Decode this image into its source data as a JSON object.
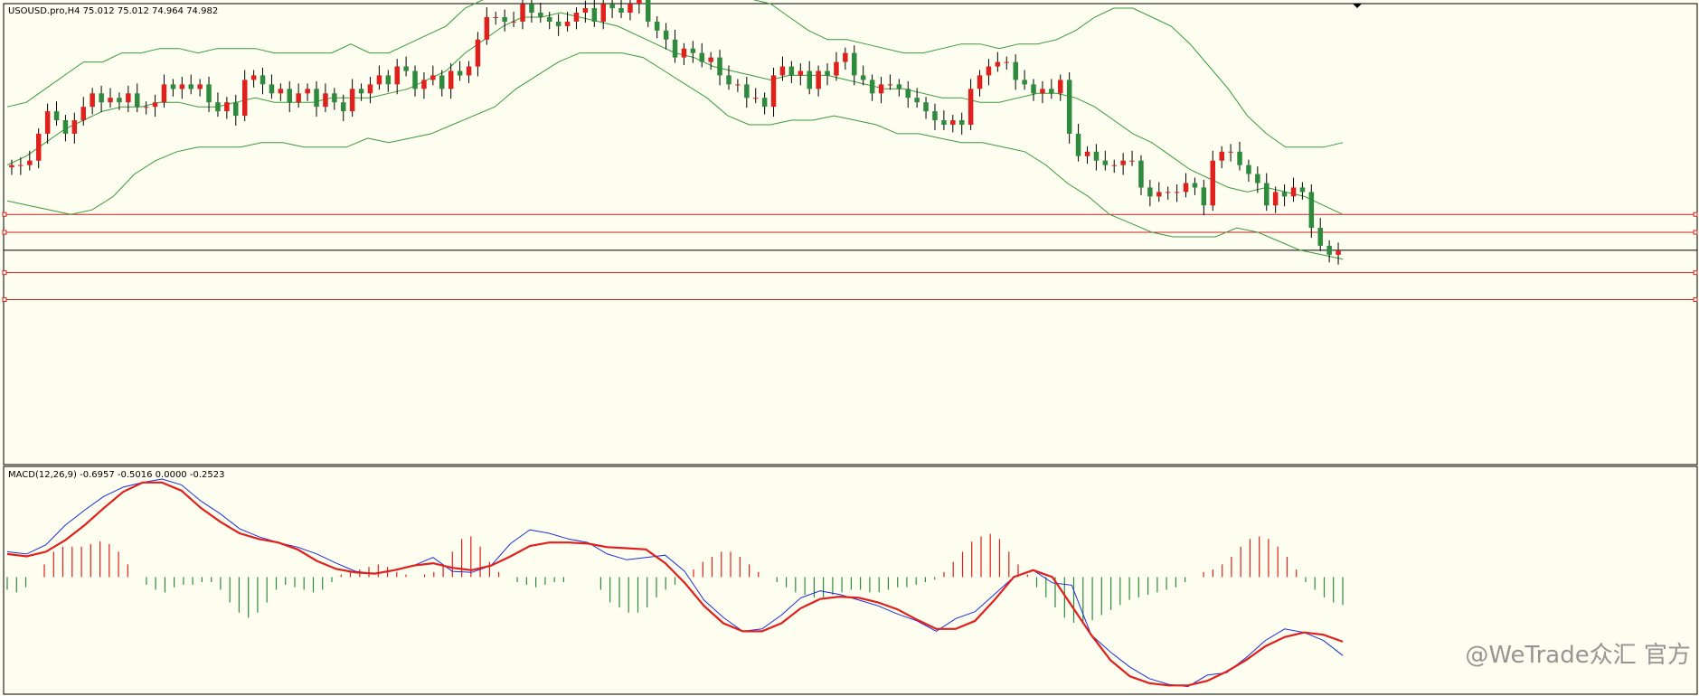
{
  "window": {
    "price_header": "USOUSD.pro,H4  75.012 75.012 74.964 74.982",
    "macd_header": "MACD(12,26,9) -0.6957 -0.5016 0.0000 -0.2523",
    "watermark": "@WeTrade众汇 官方"
  },
  "colors": {
    "background": "#fdfdf0",
    "bull_candle": "#e0201c",
    "bear_candle": "#2e8b3e",
    "bollinger": "#3a9a3a",
    "level_lines": "#d02020",
    "current_price_line": "#000000",
    "macd_line": "#1c2fd8",
    "signal_line": "#e0201c",
    "hist_positive": "#e0201c",
    "hist_negative": "#2e8b3e"
  },
  "chart_data": [
    {
      "type": "candlestick",
      "symbol": "USOUSD.pro",
      "timeframe": "H4",
      "ohlc_last": {
        "open": 75.012,
        "high": 75.012,
        "low": 74.964,
        "close": 74.982
      },
      "ylim": [
        73.0,
        83.0
      ],
      "close_series": [
        79.6,
        79.6,
        79.7,
        80.3,
        80.8,
        80.6,
        80.3,
        80.6,
        80.9,
        81.2,
        81.0,
        81.1,
        81.0,
        81.2,
        80.9,
        80.9,
        81.0,
        81.4,
        81.3,
        81.4,
        81.3,
        81.4,
        81.0,
        80.8,
        81.0,
        80.7,
        81.5,
        81.6,
        81.4,
        81.2,
        81.3,
        81.0,
        81.2,
        81.3,
        80.9,
        81.2,
        81.0,
        80.8,
        81.3,
        81.2,
        81.4,
        81.6,
        81.4,
        81.8,
        81.7,
        81.3,
        81.5,
        81.6,
        81.3,
        81.7,
        81.6,
        81.8,
        82.4,
        82.9,
        82.9,
        82.8,
        82.8,
        83.2,
        83.0,
        82.9,
        82.8,
        82.7,
        82.8,
        83.0,
        83.1,
        82.8,
        83.2,
        83.1,
        83.0,
        83.2,
        83.3,
        82.8,
        82.6,
        82.4,
        82.0,
        82.2,
        82.1,
        81.9,
        82.0,
        81.6,
        81.4,
        81.4,
        81.1,
        81.1,
        80.9,
        81.6,
        81.8,
        81.6,
        81.7,
        81.3,
        81.7,
        81.6,
        81.9,
        82.1,
        81.6,
        81.5,
        81.2,
        81.4,
        81.4,
        81.3,
        81.1,
        81.0,
        80.8,
        80.6,
        80.5,
        80.6,
        80.5,
        81.3,
        81.6,
        81.8,
        81.9,
        81.9,
        81.5,
        81.4,
        81.2,
        81.3,
        81.2,
        81.5,
        80.3,
        79.8,
        79.9,
        79.7,
        79.6,
        79.6,
        79.7,
        79.7,
        79.1,
        78.9,
        79.0,
        79.0,
        79.0,
        79.2,
        79.1,
        78.7,
        79.7,
        79.9,
        79.9,
        79.6,
        79.4,
        79.2,
        78.7,
        79.0,
        78.9,
        79.1,
        79.0,
        78.2,
        77.8,
        77.6,
        77.7
      ]
    },
    {
      "type": "line",
      "name": "Bollinger Bands",
      "upper": [
        80.9,
        81.0,
        81.3,
        81.6,
        81.9,
        81.9,
        82.1,
        82.1,
        82.2,
        82.2,
        82.1,
        82.2,
        82.2,
        82.2,
        82.1,
        82.1,
        82.1,
        82.1,
        82.3,
        82.1,
        82.1,
        82.3,
        82.5,
        82.7,
        83.1,
        83.3,
        83.5,
        83.7,
        83.8,
        83.8,
        83.7,
        83.7,
        83.6,
        83.7,
        83.6,
        83.7,
        83.7,
        83.6,
        83.5,
        83.3,
        83.2,
        82.9,
        82.6,
        82.4,
        82.4,
        82.3,
        82.2,
        82.1,
        82.1,
        82.2,
        82.3,
        82.3,
        82.2,
        82.3,
        82.3,
        82.4,
        82.6,
        82.9,
        83.1,
        83.1,
        82.9,
        82.7,
        82.3,
        81.8,
        81.3,
        80.7,
        80.3,
        80.0,
        80.0,
        80.0,
        80.1
      ],
      "middle": [
        79.6,
        79.8,
        80.1,
        80.4,
        80.6,
        80.8,
        80.9,
        80.9,
        81.0,
        81.0,
        80.9,
        80.9,
        81.0,
        81.1,
        81.0,
        81.0,
        81.0,
        81.1,
        81.1,
        81.1,
        81.2,
        81.3,
        81.5,
        81.7,
        82.1,
        82.4,
        82.7,
        82.9,
        82.9,
        83.0,
        82.9,
        82.8,
        82.7,
        82.5,
        82.3,
        82.1,
        82.0,
        81.8,
        81.7,
        81.6,
        81.5,
        81.6,
        81.6,
        81.6,
        81.5,
        81.4,
        81.3,
        81.3,
        81.2,
        81.1,
        81.1,
        81.0,
        81.0,
        81.1,
        81.2,
        81.2,
        81.1,
        80.9,
        80.6,
        80.3,
        80.1,
        79.8,
        79.5,
        79.3,
        79.1,
        79.0,
        79.1,
        79.0,
        78.9,
        78.7,
        78.5
      ],
      "lower": [
        78.8,
        78.7,
        78.6,
        78.5,
        78.6,
        78.9,
        79.4,
        79.7,
        79.9,
        80.0,
        80.0,
        80.0,
        80.1,
        80.1,
        80.0,
        80.0,
        80.0,
        80.2,
        80.1,
        80.2,
        80.3,
        80.5,
        80.7,
        80.9,
        81.3,
        81.6,
        81.9,
        82.1,
        82.1,
        82.1,
        82.0,
        81.7,
        81.4,
        81.1,
        80.7,
        80.5,
        80.5,
        80.6,
        80.6,
        80.7,
        80.6,
        80.5,
        80.3,
        80.3,
        80.2,
        80.1,
        80.1,
        80.0,
        79.9,
        79.6,
        79.2,
        78.9,
        78.5,
        78.3,
        78.1,
        78.0,
        78.0,
        78.0,
        78.2,
        78.1,
        77.9,
        77.7,
        77.6,
        77.5
      ]
    },
    {
      "type": "line",
      "name": "Horizontal levels",
      "levels": [
        78.5,
        78.1,
        77.2,
        76.6
      ],
      "current_price": 77.7
    },
    {
      "type": "bar",
      "name": "MACD",
      "params": "12,26,9",
      "values": {
        "main": -0.6957,
        "signal": -0.5016,
        "third": 0.0,
        "fourth": -0.2523
      },
      "ylim": [
        -1.0,
        0.85
      ],
      "macd": [
        0.22,
        0.2,
        0.28,
        0.45,
        0.58,
        0.7,
        0.78,
        0.82,
        0.85,
        0.8,
        0.66,
        0.55,
        0.42,
        0.35,
        0.3,
        0.26,
        0.2,
        0.12,
        0.05,
        0.03,
        0.06,
        0.1,
        0.17,
        0.05,
        0.04,
        0.1,
        0.29,
        0.41,
        0.38,
        0.33,
        0.3,
        0.2,
        0.15,
        0.17,
        0.19,
        0.05,
        -0.2,
        -0.35,
        -0.47,
        -0.45,
        -0.33,
        -0.18,
        -0.12,
        -0.15,
        -0.2,
        -0.25,
        -0.32,
        -0.38,
        -0.47,
        -0.36,
        -0.3,
        -0.15,
        0.0,
        0.06,
        -0.05,
        -0.07,
        -0.5,
        -0.65,
        -0.78,
        -0.88,
        -0.93,
        -0.95,
        -0.85,
        -0.83,
        -0.7,
        -0.55,
        -0.45,
        -0.48,
        -0.55,
        -0.68
      ],
      "signal": [
        0.2,
        0.18,
        0.22,
        0.32,
        0.45,
        0.6,
        0.74,
        0.82,
        0.82,
        0.75,
        0.6,
        0.48,
        0.38,
        0.33,
        0.3,
        0.24,
        0.14,
        0.07,
        0.04,
        0.03,
        0.06,
        0.1,
        0.12,
        0.08,
        0.06,
        0.1,
        0.18,
        0.27,
        0.3,
        0.3,
        0.29,
        0.26,
        0.25,
        0.24,
        0.12,
        -0.05,
        -0.25,
        -0.4,
        -0.47,
        -0.47,
        -0.4,
        -0.27,
        -0.19,
        -0.17,
        -0.18,
        -0.22,
        -0.28,
        -0.37,
        -0.45,
        -0.45,
        -0.38,
        -0.2,
        0.0,
        0.06,
        0.0,
        -0.25,
        -0.5,
        -0.72,
        -0.86,
        -0.92,
        -0.94,
        -0.94,
        -0.9,
        -0.82,
        -0.72,
        -0.6,
        -0.52,
        -0.48,
        -0.5,
        -0.56
      ],
      "histogram": [
        -0.05,
        -0.06,
        -0.04,
        0.0,
        0.05,
        0.1,
        0.12,
        0.12,
        0.12,
        0.13,
        0.14,
        0.13,
        0.1,
        0.05,
        0.0,
        -0.03,
        -0.05,
        -0.06,
        -0.04,
        -0.03,
        -0.03,
        -0.02,
        -0.02,
        -0.05,
        -0.1,
        -0.14,
        -0.16,
        -0.14,
        -0.1,
        -0.05,
        -0.03,
        -0.04,
        -0.05,
        -0.06,
        -0.05,
        -0.02,
        0.01,
        0.02,
        0.03,
        0.04,
        0.05,
        0.04,
        0.02,
        0.01,
        0.0,
        0.01,
        0.02,
        0.05,
        0.1,
        0.15,
        0.16,
        0.12,
        0.06,
        0.02,
        0.0,
        -0.02,
        -0.03,
        -0.04,
        -0.03,
        -0.02,
        -0.02,
        0.0,
        0.0,
        0.0,
        -0.05,
        -0.1,
        -0.12,
        -0.14,
        -0.14,
        -0.12,
        -0.08,
        -0.05,
        -0.03,
        0.0,
        0.03,
        0.06,
        0.08,
        0.1,
        0.1,
        0.08,
        0.05,
        0.02,
        0.0,
        -0.02,
        -0.04,
        -0.06,
        -0.07,
        -0.08,
        -0.08,
        -0.07,
        -0.06,
        -0.05,
        -0.05,
        -0.06,
        -0.06,
        -0.05,
        -0.04,
        -0.04,
        -0.03,
        -0.02,
        -0.01,
        0.02,
        0.06,
        0.1,
        0.14,
        0.16,
        0.17,
        0.15,
        0.1,
        0.05,
        0.01,
        -0.04,
        -0.08,
        -0.12,
        -0.16,
        -0.18,
        -0.18,
        -0.17,
        -0.15,
        -0.13,
        -0.11,
        -0.09,
        -0.08,
        -0.07,
        -0.06,
        -0.05,
        -0.04,
        -0.02,
        0.0,
        0.02,
        0.03,
        0.05,
        0.08,
        0.12,
        0.15,
        0.16,
        0.15,
        0.12,
        0.08,
        0.03,
        -0.02,
        -0.05,
        -0.08,
        -0.1,
        -0.11
      ]
    }
  ]
}
